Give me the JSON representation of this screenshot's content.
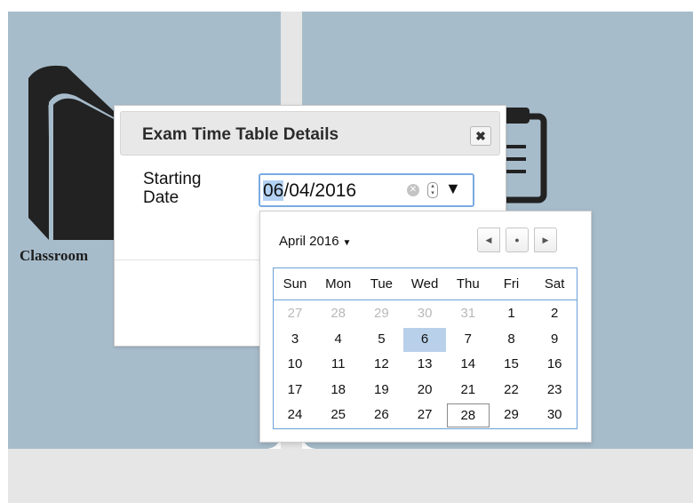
{
  "background": {
    "tile_color": "#a7bccb",
    "left_tile_label": "Classroom",
    "left_tile_icon": "book-icon",
    "right_tile_icon": "clipboard-icon"
  },
  "dialog": {
    "title": "Exam Time Table Details",
    "close_icon": "close-icon",
    "field_label": "Starting Date",
    "date_value": {
      "selected_part": "06",
      "rest": "/04/2016"
    }
  },
  "calendar": {
    "month_label": "April 2016",
    "weekdays": [
      "Sun",
      "Mon",
      "Tue",
      "Wed",
      "Thu",
      "Fri",
      "Sat"
    ],
    "weeks": [
      [
        "27",
        "28",
        "29",
        "30",
        "31",
        "1",
        "2"
      ],
      [
        "3",
        "4",
        "5",
        "6",
        "7",
        "8",
        "9"
      ],
      [
        "10",
        "11",
        "12",
        "13",
        "14",
        "15",
        "16"
      ],
      [
        "17",
        "18",
        "19",
        "20",
        "21",
        "22",
        "23"
      ],
      [
        "24",
        "25",
        "26",
        "27",
        "28",
        "29",
        "30"
      ]
    ],
    "outside_month_days": [
      "27",
      "28",
      "29",
      "30",
      "31"
    ],
    "selected_day": "6",
    "today_day": "28",
    "selected_color": "#b9d0ea"
  }
}
